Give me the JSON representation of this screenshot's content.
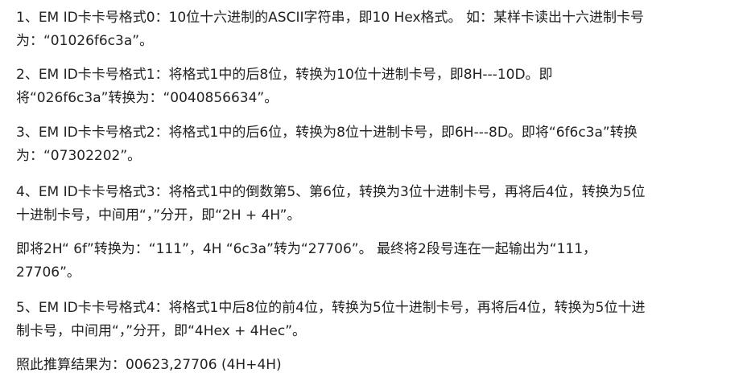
{
  "paragraphs": [
    {
      "lines": [
        "1、EM ID卡卡号格式0：10位十六进制的ASCII字符串，即10 Hex格式。 如：某样卡读出十六进制卡号",
        "为：“01026f6c3a”。"
      ]
    },
    {
      "lines": [
        "2、EM ID卡卡号格式1：将格式1中的后8位，转换为10位十进制卡号，即8H---10D。即",
        "将“026f6c3a”转换为：“0040856634”。"
      ]
    },
    {
      "lines": [
        "3、EM ID卡卡号格式2：将格式1中的后6位，转换为8位十进制卡号，即6H---8D。即将“6f6c3a”转换",
        "为：“07302202”。"
      ]
    },
    {
      "lines": [
        "4、EM ID卡卡号格式3：将格式1中的倒数第5、第6位，转换为3位十进制卡号，再将后4位，转换为5位",
        "十进制卡号，中间用“，”分开，即“2H + 4H”。"
      ]
    },
    {
      "lines": [
        "即将2H“ 6f”转换为：“111”，4H “6c3a”转为“27706”。 最终将2段号连在一起输出为“111，",
        "27706”。"
      ]
    },
    {
      "lines": [
        "5、EM ID卡卡号格式4：将格式1中后8位的前4位，转换为5位十进制卡号，再将后4位，转换为5位十进",
        "制卡号，中间用“，”分开，即“4Hex + 4Hec”。"
      ]
    },
    {
      "lines": [
        "照此推算结果为：00623,27706 (4H+4H)"
      ]
    }
  ]
}
